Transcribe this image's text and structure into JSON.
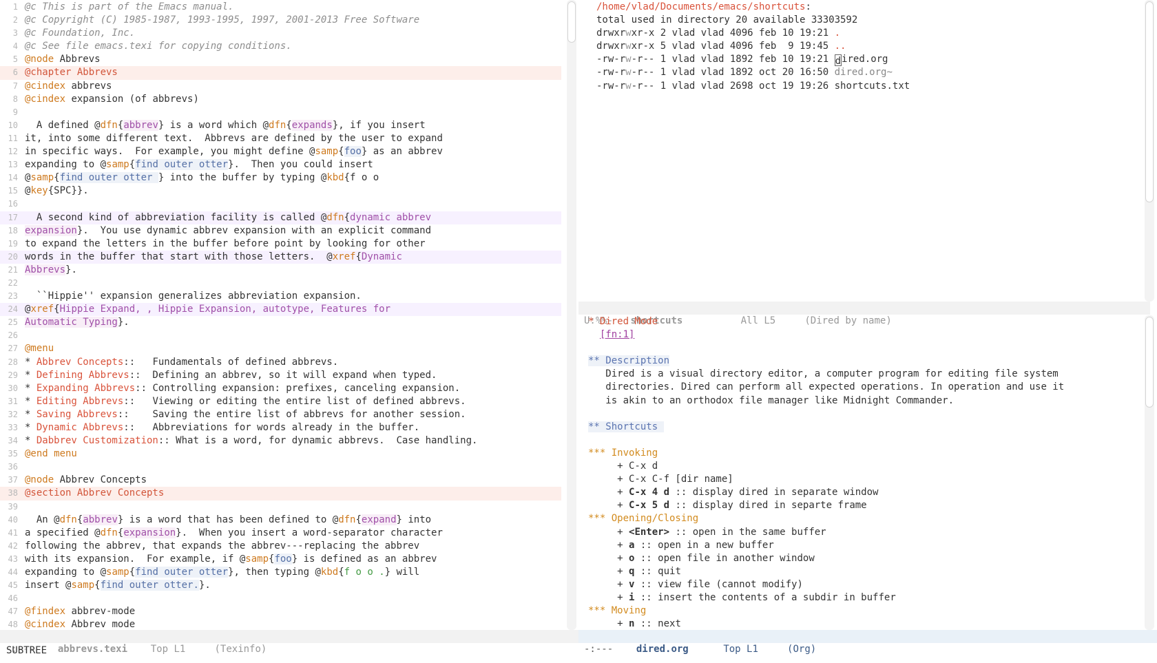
{
  "left_buffer": {
    "lines": [
      {
        "n": "1",
        "segs": [
          {
            "t": "@c This is part of the Emacs manual.",
            "c": "cmt"
          }
        ]
      },
      {
        "n": "2",
        "segs": [
          {
            "t": "@c Copyright (C) 1985-1987, 1993-1995, 1997, 2001-2013 Free Software",
            "c": "cmt"
          }
        ]
      },
      {
        "n": "3",
        "segs": [
          {
            "t": "@c Foundation, Inc.",
            "c": "cmt"
          }
        ]
      },
      {
        "n": "4",
        "segs": [
          {
            "t": "@c See file emacs.texi for copying conditions.",
            "c": "cmt"
          }
        ]
      },
      {
        "n": "5",
        "segs": [
          {
            "t": "@node",
            "c": "kw"
          },
          {
            "t": " Abbrevs"
          }
        ]
      },
      {
        "n": "6",
        "hl": "hl-red",
        "segs": [
          {
            "t": "@chapter Abbrevs",
            "c": "ch"
          }
        ]
      },
      {
        "n": "7",
        "segs": [
          {
            "t": "@cindex",
            "c": "kw"
          },
          {
            "t": " abbrevs"
          }
        ]
      },
      {
        "n": "8",
        "segs": [
          {
            "t": "@cindex",
            "c": "kw"
          },
          {
            "t": " expansion (of abbrevs)"
          }
        ]
      },
      {
        "n": "9",
        "segs": []
      },
      {
        "n": "10",
        "segs": [
          {
            "t": "  A defined @"
          },
          {
            "t": "dfn",
            "c": "kw"
          },
          {
            "t": "{"
          },
          {
            "t": "abbrev",
            "c": "pur hl-pur"
          },
          {
            "t": "} is a word which @"
          },
          {
            "t": "dfn",
            "c": "kw"
          },
          {
            "t": "{"
          },
          {
            "t": "expands",
            "c": "pur hl-pur"
          },
          {
            "t": "}, if you insert"
          }
        ]
      },
      {
        "n": "11",
        "segs": [
          {
            "t": "it, into some different text.  Abbrevs are defined by the user to expand"
          }
        ]
      },
      {
        "n": "12",
        "segs": [
          {
            "t": "in specific ways.  For example, you might define @"
          },
          {
            "t": "samp",
            "c": "kw"
          },
          {
            "t": "{"
          },
          {
            "t": "foo",
            "c": "blu hl-blu"
          },
          {
            "t": "} as an abbrev"
          }
        ]
      },
      {
        "n": "13",
        "segs": [
          {
            "t": "expanding to @"
          },
          {
            "t": "samp",
            "c": "kw"
          },
          {
            "t": "{"
          },
          {
            "t": "find outer otter",
            "c": "blu hl-blu"
          },
          {
            "t": "}.  Then you could insert"
          }
        ]
      },
      {
        "n": "14",
        "segs": [
          {
            "t": "@"
          },
          {
            "t": "samp",
            "c": "kw"
          },
          {
            "t": "{"
          },
          {
            "t": "find outer otter ",
            "c": "blu hl-blu"
          },
          {
            "t": "} into the buffer by typing @"
          },
          {
            "t": "kbd",
            "c": "kw"
          },
          {
            "t": "{f o o"
          }
        ]
      },
      {
        "n": "15",
        "segs": [
          {
            "t": "@"
          },
          {
            "t": "key",
            "c": "kw"
          },
          {
            "t": "{SPC}}."
          }
        ]
      },
      {
        "n": "16",
        "segs": []
      },
      {
        "n": "17",
        "hl": "hl-line",
        "segs": [
          {
            "t": "  A second kind of abbreviation facility is called @"
          },
          {
            "t": "dfn",
            "c": "kw"
          },
          {
            "t": "{"
          },
          {
            "t": "dynamic abbrev",
            "c": "pur"
          }
        ]
      },
      {
        "n": "18",
        "segs": [
          {
            "t": "expansion",
            "c": "pur hl-pur"
          },
          {
            "t": "}.  You use dynamic abbrev expansion with an explicit command"
          }
        ]
      },
      {
        "n": "19",
        "segs": [
          {
            "t": "to expand the letters in the buffer before point by looking for other"
          }
        ]
      },
      {
        "n": "20",
        "hl": "hl-line",
        "segs": [
          {
            "t": "words in the buffer that start with those letters.  @"
          },
          {
            "t": "xref",
            "c": "kw"
          },
          {
            "t": "{"
          },
          {
            "t": "Dynamic",
            "c": "pur"
          }
        ]
      },
      {
        "n": "21",
        "segs": [
          {
            "t": "Abbrevs",
            "c": "pur hl-pur"
          },
          {
            "t": "}."
          }
        ]
      },
      {
        "n": "22",
        "segs": []
      },
      {
        "n": "23",
        "segs": [
          {
            "t": "  ``Hippie'' expansion generalizes abbreviation expansion."
          }
        ]
      },
      {
        "n": "24",
        "hl": "hl-line",
        "segs": [
          {
            "t": "@"
          },
          {
            "t": "xref",
            "c": "kw"
          },
          {
            "t": "{"
          },
          {
            "t": "Hippie Expand, , Hippie Expansion, autotype, Features for",
            "c": "pur"
          }
        ]
      },
      {
        "n": "25",
        "segs": [
          {
            "t": "Automatic Typing",
            "c": "pur hl-pur"
          },
          {
            "t": "}."
          }
        ]
      },
      {
        "n": "26",
        "segs": []
      },
      {
        "n": "27",
        "segs": [
          {
            "t": "@menu",
            "c": "kw"
          }
        ]
      },
      {
        "n": "28",
        "segs": [
          {
            "t": "* "
          },
          {
            "t": "Abbrev Concepts",
            "c": "red"
          },
          {
            "t": "::   Fundamentals of defined abbrevs."
          }
        ]
      },
      {
        "n": "29",
        "segs": [
          {
            "t": "* "
          },
          {
            "t": "Defining Abbrevs",
            "c": "red"
          },
          {
            "t": "::  Defining an abbrev, so it will expand when typed."
          }
        ]
      },
      {
        "n": "30",
        "segs": [
          {
            "t": "* "
          },
          {
            "t": "Expanding Abbrevs",
            "c": "red"
          },
          {
            "t": ":: Controlling expansion: prefixes, canceling expansion."
          }
        ]
      },
      {
        "n": "31",
        "segs": [
          {
            "t": "* "
          },
          {
            "t": "Editing Abbrevs",
            "c": "red"
          },
          {
            "t": "::   Viewing or editing the entire list of defined abbrevs."
          }
        ]
      },
      {
        "n": "32",
        "segs": [
          {
            "t": "* "
          },
          {
            "t": "Saving Abbrevs",
            "c": "red"
          },
          {
            "t": "::    Saving the entire list of abbrevs for another session."
          }
        ]
      },
      {
        "n": "33",
        "segs": [
          {
            "t": "* "
          },
          {
            "t": "Dynamic Abbrevs",
            "c": "red"
          },
          {
            "t": "::   Abbreviations for words already in the buffer."
          }
        ]
      },
      {
        "n": "34",
        "segs": [
          {
            "t": "* "
          },
          {
            "t": "Dabbrev Customization",
            "c": "red"
          },
          {
            "t": ":: What is a word, for dynamic abbrevs.  Case handling."
          }
        ]
      },
      {
        "n": "35",
        "segs": [
          {
            "t": "@end menu",
            "c": "kw"
          }
        ]
      },
      {
        "n": "36",
        "segs": []
      },
      {
        "n": "37",
        "segs": [
          {
            "t": "@node",
            "c": "kw"
          },
          {
            "t": " Abbrev Concepts"
          }
        ]
      },
      {
        "n": "38",
        "hl": "hl-red",
        "segs": [
          {
            "t": "@section Abbrev Concepts",
            "c": "ch"
          }
        ]
      },
      {
        "n": "39",
        "segs": []
      },
      {
        "n": "40",
        "segs": [
          {
            "t": "  An @"
          },
          {
            "t": "dfn",
            "c": "kw"
          },
          {
            "t": "{"
          },
          {
            "t": "abbrev",
            "c": "pur hl-pur"
          },
          {
            "t": "} is a word that has been defined to @"
          },
          {
            "t": "dfn",
            "c": "kw"
          },
          {
            "t": "{"
          },
          {
            "t": "expand",
            "c": "pur hl-pur"
          },
          {
            "t": "} into"
          }
        ]
      },
      {
        "n": "41",
        "segs": [
          {
            "t": "a specified @"
          },
          {
            "t": "dfn",
            "c": "kw"
          },
          {
            "t": "{"
          },
          {
            "t": "expansion",
            "c": "pur hl-pur"
          },
          {
            "t": "}.  When you insert a word-separator character"
          }
        ]
      },
      {
        "n": "42",
        "segs": [
          {
            "t": "following the abbrev, that expands the abbrev---replacing the abbrev"
          }
        ]
      },
      {
        "n": "43",
        "segs": [
          {
            "t": "with its expansion.  For example, if @"
          },
          {
            "t": "samp",
            "c": "kw"
          },
          {
            "t": "{"
          },
          {
            "t": "foo",
            "c": "blu hl-blu"
          },
          {
            "t": "} is defined as an abbrev"
          }
        ]
      },
      {
        "n": "44",
        "segs": [
          {
            "t": "expanding to @"
          },
          {
            "t": "samp",
            "c": "kw"
          },
          {
            "t": "{"
          },
          {
            "t": "find outer otter",
            "c": "blu hl-blu"
          },
          {
            "t": "}, then typing @"
          },
          {
            "t": "kbd",
            "c": "kw"
          },
          {
            "t": "{"
          },
          {
            "t": "f o o .",
            "c": "grn"
          },
          {
            "t": "} will"
          }
        ]
      },
      {
        "n": "45",
        "segs": [
          {
            "t": "insert @"
          },
          {
            "t": "samp",
            "c": "kw"
          },
          {
            "t": "{"
          },
          {
            "t": "find outer otter.",
            "c": "blu hl-blu"
          },
          {
            "t": "}."
          }
        ]
      },
      {
        "n": "46",
        "segs": []
      },
      {
        "n": "47",
        "segs": [
          {
            "t": "@findex",
            "c": "kw"
          },
          {
            "t": " abbrev-mode"
          }
        ]
      },
      {
        "n": "48",
        "segs": [
          {
            "t": "@cindex",
            "c": "kw"
          },
          {
            "t": " Abbrev mode"
          }
        ]
      }
    ],
    "modeline": {
      "status": "-:---",
      "buffer": "abbrevs.texi",
      "pos": "Top L1",
      "mode": "(Texinfo)"
    }
  },
  "dired_buffer": {
    "lines": [
      {
        "segs": [
          {
            "t": "/home/vlad/Documents/emacs/shortcuts",
            "c": "red"
          },
          {
            "t": ":"
          }
        ]
      },
      {
        "segs": [
          {
            "t": "total used in directory 20 available 33303592"
          }
        ]
      },
      {
        "segs": [
          {
            "t": "drwxr"
          },
          {
            "t": "w",
            "c": "grey"
          },
          {
            "t": "xr-x 2 vlad vlad 4096 feb 10 19:21 "
          },
          {
            "t": ".",
            "c": "red"
          }
        ]
      },
      {
        "segs": [
          {
            "t": "drwxr"
          },
          {
            "t": "w",
            "c": "grey"
          },
          {
            "t": "xr-x 5 vlad vlad 4096 feb  9 19:45 "
          },
          {
            "t": "..",
            "c": "red"
          }
        ]
      },
      {
        "segs": [
          {
            "t": "-rw-r"
          },
          {
            "t": "w",
            "c": "grey"
          },
          {
            "t": "-r-- 1 vlad vlad 1892 feb 10 19:21 "
          },
          {
            "t": "d",
            "c": "cur"
          },
          {
            "t": "ired.org"
          }
        ]
      },
      {
        "segs": [
          {
            "t": "-rw-r"
          },
          {
            "t": "w",
            "c": "grey"
          },
          {
            "t": "-r-- 1 vlad vlad 1892 oct 20 16:50 "
          },
          {
            "t": "dired.org~",
            "c": "dim"
          }
        ]
      },
      {
        "segs": [
          {
            "t": "-rw-r"
          },
          {
            "t": "w",
            "c": "grey"
          },
          {
            "t": "-r-- 1 vlad vlad 2698 oct 19 19:26 shortcuts.txt"
          }
        ]
      }
    ],
    "modeline": {
      "status": "U:%%-",
      "buffer": "shortcuts",
      "pos": "All L5",
      "mode": "(Dired by name)"
    }
  },
  "org_buffer": {
    "lines": [
      {
        "segs": [
          {
            "t": "* Dired Mode",
            "c": "org-h1"
          }
        ]
      },
      {
        "segs": [
          {
            "t": "  "
          },
          {
            "t": "[fn:1]",
            "c": "link"
          }
        ]
      },
      {
        "segs": []
      },
      {
        "segs": [
          {
            "t": "** Description",
            "c": "org-h2 hl-blu"
          }
        ]
      },
      {
        "segs": [
          {
            "t": "   Dired is a visual directory editor, a computer program for editing file system"
          }
        ]
      },
      {
        "segs": [
          {
            "t": "   directories. Dired can perform all expected operations. In operation and use it"
          }
        ]
      },
      {
        "segs": [
          {
            "t": "   is akin to an orthodox file manager like Midnight Commander."
          }
        ]
      },
      {
        "segs": []
      },
      {
        "segs": [
          {
            "t": "** Shortcuts ",
            "c": "org-h2 hl-blu"
          }
        ]
      },
      {
        "segs": []
      },
      {
        "segs": [
          {
            "t": "*** Invoking",
            "c": "org-h3"
          }
        ]
      },
      {
        "segs": [
          {
            "t": "     + C-x d"
          }
        ]
      },
      {
        "segs": [
          {
            "t": "     + C-x C-f [dir name]"
          }
        ]
      },
      {
        "segs": [
          {
            "t": "     + "
          },
          {
            "t": "C-x 4 d",
            "c": "bold"
          },
          {
            "t": " :: display dired in separate window"
          }
        ]
      },
      {
        "segs": [
          {
            "t": "     + "
          },
          {
            "t": "C-x 5 d",
            "c": "bold"
          },
          {
            "t": " :: display dired in separte frame"
          }
        ]
      },
      {
        "segs": [
          {
            "t": "*** Opening/Closing",
            "c": "org-h3"
          }
        ]
      },
      {
        "segs": [
          {
            "t": "     + "
          },
          {
            "t": "<Enter>",
            "c": "bold"
          },
          {
            "t": " :: open in the same buffer"
          }
        ]
      },
      {
        "segs": [
          {
            "t": "     + "
          },
          {
            "t": "a",
            "c": "bold"
          },
          {
            "t": " :: open in a new buffer"
          }
        ]
      },
      {
        "segs": [
          {
            "t": "     + "
          },
          {
            "t": "o",
            "c": "bold"
          },
          {
            "t": " :: open file in another window"
          }
        ]
      },
      {
        "segs": [
          {
            "t": "     + "
          },
          {
            "t": "q",
            "c": "bold"
          },
          {
            "t": " :: quit"
          }
        ]
      },
      {
        "segs": [
          {
            "t": "     + "
          },
          {
            "t": "v",
            "c": "bold"
          },
          {
            "t": " :: view file (cannot modify)"
          }
        ]
      },
      {
        "segs": [
          {
            "t": "     + "
          },
          {
            "t": "i",
            "c": "bold"
          },
          {
            "t": " :: insert the contents of a subdir in buffer"
          }
        ]
      },
      {
        "segs": [
          {
            "t": "*** Moving",
            "c": "org-h3"
          }
        ]
      },
      {
        "segs": [
          {
            "t": "     + "
          },
          {
            "t": "n",
            "c": "bold"
          },
          {
            "t": " :: next"
          }
        ]
      }
    ],
    "modeline": {
      "status": "-:---",
      "buffer": "dired.org",
      "pos": "Top L1",
      "mode": "(Org)"
    }
  },
  "echo_area": "SUBTREE"
}
